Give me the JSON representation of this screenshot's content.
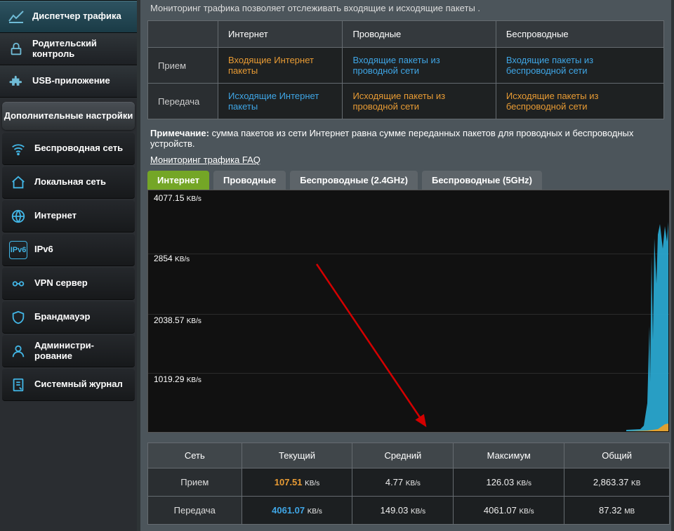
{
  "sidebar": {
    "main_items": [
      {
        "label": "Диспетчер трафика"
      },
      {
        "label": "Родительский контроль"
      },
      {
        "label": "USB-приложение"
      }
    ],
    "section_title": "Дополнительные настройки",
    "adv_items": [
      {
        "label": "Беспроводная сеть"
      },
      {
        "label": "Локальная сеть"
      },
      {
        "label": "Интернет"
      },
      {
        "label": "IPv6"
      },
      {
        "label": "VPN сервер"
      },
      {
        "label": "Брандмауэр"
      },
      {
        "label": "Администри-\nрование"
      },
      {
        "label": "Системный журнал"
      }
    ]
  },
  "intro": "Мониторинг трафика позволяет отслеживать входящие и исходящие пакеты .",
  "dir_table": {
    "cols": [
      "",
      "Интернет",
      "Проводные",
      "Беспроводные"
    ],
    "rows": [
      {
        "head": "Прием",
        "cells": [
          {
            "text": "Входящие Интернет пакеты",
            "color": "orange"
          },
          {
            "text": "Входящие пакеты из проводной сети",
            "color": "blue"
          },
          {
            "text": "Входящие пакеты из беспроводной сети",
            "color": "blue"
          }
        ]
      },
      {
        "head": "Передача",
        "cells": [
          {
            "text": "Исходящие Интернет пакеты",
            "color": "blue"
          },
          {
            "text": "Исходящие пакеты из проводной сети",
            "color": "orange"
          },
          {
            "text": "Исходящие пакеты из беспроводной сети",
            "color": "orange"
          }
        ]
      }
    ]
  },
  "note_label": "Примечание:",
  "note_text": " сумма пакетов из сети Интернет равна сумме переданных пакетов для проводных и беспроводных устройств.",
  "faq_link": "Мониторинг трафика FAQ",
  "tabs": [
    "Интернет",
    "Проводные",
    "Беспроводные (2.4GHz)",
    "Беспроводные (5GHz)"
  ],
  "chart_data": {
    "type": "area",
    "ylabel_unit": "KB/s",
    "y_ticks": [
      1019.29,
      2038.57,
      2854.0,
      4077.15
    ],
    "ylim": [
      0,
      4077.15
    ],
    "series": [
      {
        "name": "Передача",
        "color": "#2aa6cf",
        "current": 4061.07
      },
      {
        "name": "Прием",
        "color": "#e89b34",
        "current": 107.51
      }
    ]
  },
  "stats_table": {
    "cols": [
      "Сеть",
      "Текущий",
      "Средний",
      "Максимум",
      "Общий"
    ],
    "rows": [
      {
        "head": "Прием",
        "color": "orange",
        "current": "107.51",
        "avg": "4.77",
        "max": "126.03",
        "total": "2,863.37",
        "unit_rate": "KB/s",
        "unit_total": "KB"
      },
      {
        "head": "Передача",
        "color": "blue",
        "current": "4061.07",
        "avg": "149.03",
        "max": "4061.07",
        "total": "87.32",
        "unit_rate": "KB/s",
        "unit_total": "MB"
      }
    ]
  }
}
